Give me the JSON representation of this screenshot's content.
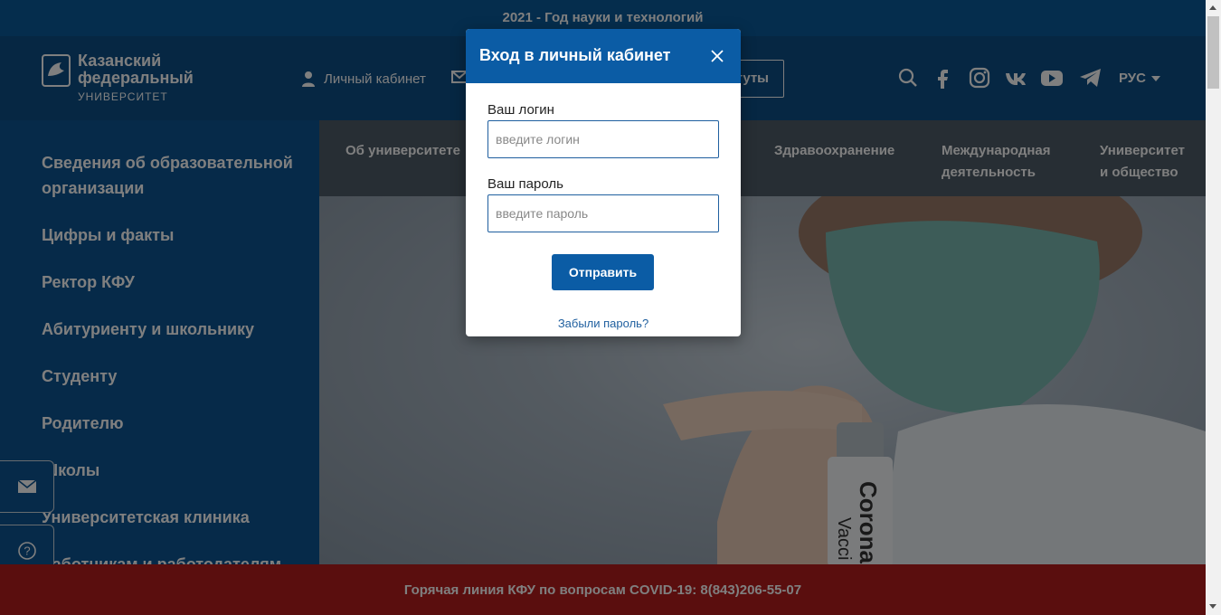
{
  "topbar": {
    "text": "2021 - Год науки и технологий"
  },
  "logo": {
    "line1": "Казанский",
    "line2": "федеральный",
    "line3": "УНИВЕРСИТЕТ"
  },
  "header": {
    "cabinet_label": "Личный кабинет",
    "institutes_label": "туты",
    "lang_label": "РУС"
  },
  "sidebar": {
    "items": [
      {
        "label": "Сведения об образовательной организации"
      },
      {
        "label": "Цифры и факты"
      },
      {
        "label": "Ректор КФУ"
      },
      {
        "label": "Абитуриенту и школьнику"
      },
      {
        "label": "Студенту"
      },
      {
        "label": "Родителю"
      },
      {
        "label": "Школы"
      },
      {
        "label": "Университетская клиника"
      },
      {
        "label": "Работникам и работодателям"
      }
    ]
  },
  "nav": {
    "items": [
      {
        "label": "Об университете"
      },
      {
        "label": "Здравоохранение"
      },
      {
        "label": "Международная деятельность"
      },
      {
        "label": "Университет и общество"
      }
    ]
  },
  "hero": {
    "vial_line1": "Corona",
    "vial_line2": "Vacci"
  },
  "hotline": {
    "text": "Горячая линия КФУ по вопросам COVID-19: 8(843)206-55-07"
  },
  "modal": {
    "title": "Вход в личный кабинет",
    "login_label": "Ваш логин",
    "login_placeholder": "введите логин",
    "login_value": "",
    "password_label": "Ваш пароль",
    "password_placeholder": "введите пароль",
    "password_value": "",
    "submit_label": "Отправить",
    "forgot_label": "Забыли пароль?"
  },
  "colors": {
    "brand_blue": "#0b5ca5",
    "hotline_red": "#b51d1d",
    "overlay": "rgba(0,0,0,0.5)"
  },
  "icons": [
    "logo-emblem",
    "user-icon",
    "mail-icon",
    "search-icon",
    "facebook-icon",
    "instagram-icon",
    "vk-icon",
    "youtube-icon",
    "telegram-icon",
    "caret-down-icon",
    "close-icon",
    "envelope-icon",
    "question-icon"
  ]
}
